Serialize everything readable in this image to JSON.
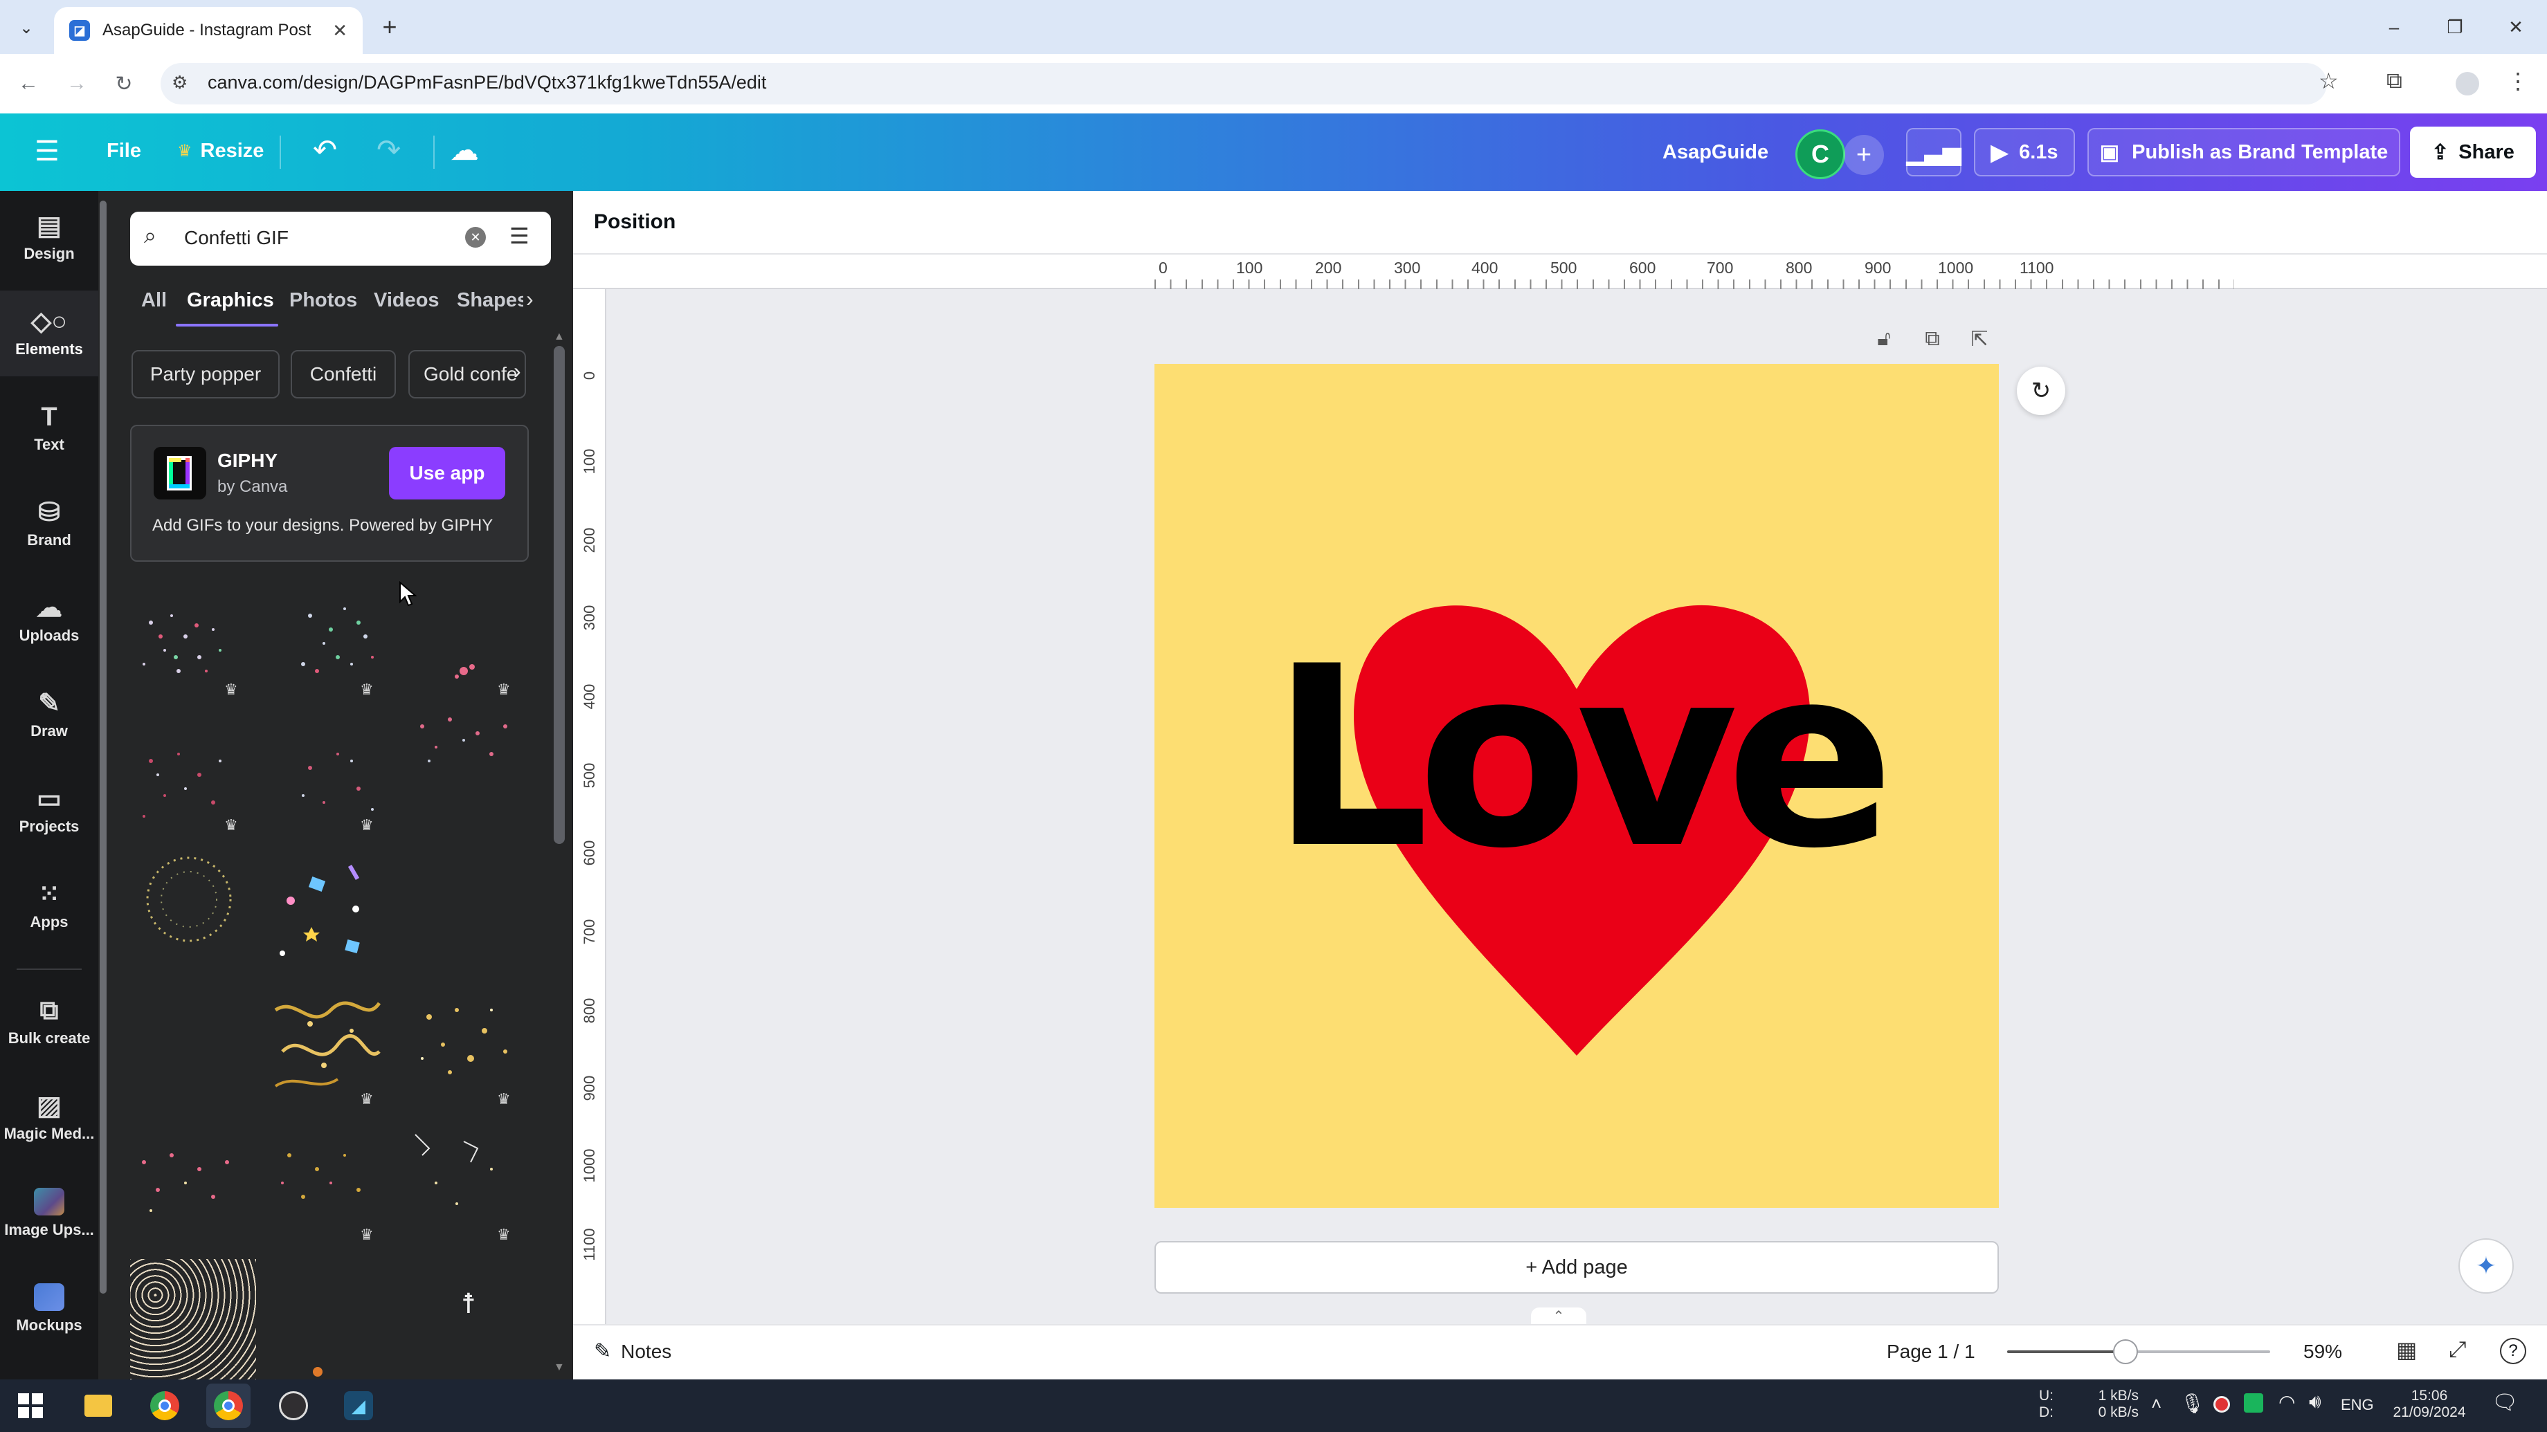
{
  "browser": {
    "tab_title": "AsapGuide - Instagram Post",
    "url": "canva.com/design/DAGPmFasnPE/bdVQtx371kfg1kweTdn55A/edit"
  },
  "header": {
    "menu_label": "File",
    "resize_label": "Resize",
    "team_name": "AsapGuide",
    "avatar_letter": "C",
    "play_duration": "6.1s",
    "publish_label": "Publish as Brand Template",
    "share_label": "Share"
  },
  "rail": {
    "items": [
      {
        "label": "Design",
        "icon": "design-icon"
      },
      {
        "label": "Elements",
        "icon": "elements-icon"
      },
      {
        "label": "Text",
        "icon": "text-icon"
      },
      {
        "label": "Brand",
        "icon": "brand-icon"
      },
      {
        "label": "Uploads",
        "icon": "uploads-icon"
      },
      {
        "label": "Draw",
        "icon": "draw-icon"
      },
      {
        "label": "Projects",
        "icon": "projects-icon"
      },
      {
        "label": "Apps",
        "icon": "apps-icon"
      },
      {
        "label": "Bulk create",
        "icon": "bulk-create-icon"
      },
      {
        "label": "Magic Med...",
        "icon": "magic-media-icon"
      },
      {
        "label": "Image Ups...",
        "icon": "image-upscaler-icon"
      },
      {
        "label": "Mockups",
        "icon": "mockups-icon"
      }
    ]
  },
  "panel": {
    "search_value": "Confetti GIF",
    "tabs": [
      "All",
      "Graphics",
      "Photos",
      "Videos",
      "Shapes"
    ],
    "active_tab": "Graphics",
    "chips": [
      "Party popper",
      "Confetti",
      "Gold confe"
    ],
    "giphy": {
      "title": "GIPHY",
      "subtitle": "by Canva",
      "button": "Use app",
      "description": "Add GIFs to your designs. Powered by GIPHY"
    }
  },
  "editor": {
    "context_label": "Position",
    "ruler_h": [
      "0",
      "100",
      "200",
      "300",
      "400",
      "500",
      "600",
      "700",
      "800",
      "900",
      "1000",
      "1100"
    ],
    "ruler_v": [
      "0",
      "100",
      "200",
      "300",
      "400",
      "500",
      "600",
      "700",
      "800",
      "900",
      "1000",
      "1100"
    ],
    "design_text": "Love",
    "add_page_label": "+ Add page",
    "colors": {
      "canvas_bg": "#fdde72",
      "heart": "#ea0017",
      "text": "#000000"
    }
  },
  "footer": {
    "notes_label": "Notes",
    "page_indicator": "Page 1 / 1",
    "zoom_level": "59%",
    "zoom_fraction": 0.45
  },
  "taskbar": {
    "network_up": "1 kB/s",
    "network_down": "0 kB/s",
    "up_label": "U:",
    "down_label": "D:",
    "language": "ENG",
    "time": "15:06",
    "date": "21/09/2024"
  }
}
